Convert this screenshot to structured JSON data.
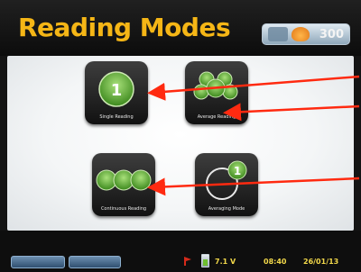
{
  "header": {
    "title": "Reading Modes",
    "brand_text": "300"
  },
  "tiles": [
    {
      "glyph": "1",
      "label": "Single Reading"
    },
    {
      "label": "Average Reading"
    },
    {
      "label": "Continuous Reading"
    },
    {
      "glyph": "1",
      "label": "Averaging Mode"
    }
  ],
  "footer": {
    "buttons": [
      "",
      ""
    ],
    "voltage": "7.1 V",
    "time": "08:40",
    "date": "26/01/13"
  },
  "colors": {
    "accent": "#f5b616",
    "tile_green": "#7fc24a",
    "arrow": "#ff2a10"
  }
}
